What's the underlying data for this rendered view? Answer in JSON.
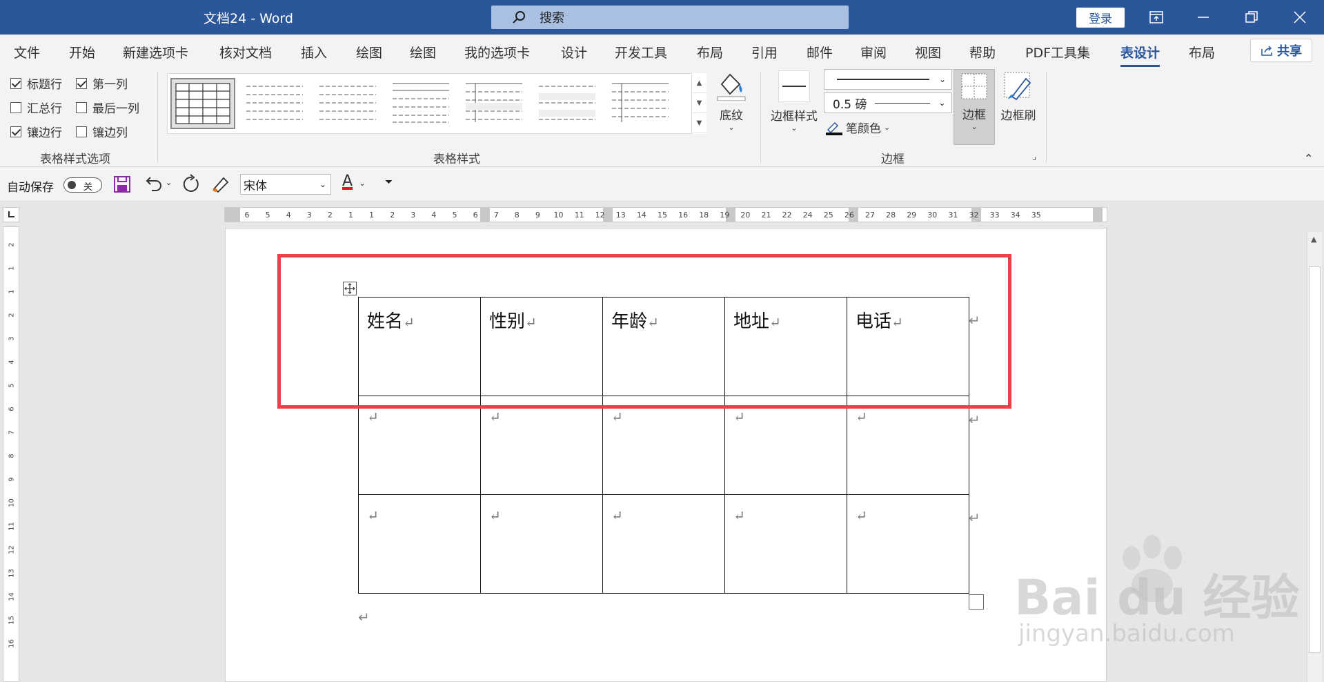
{
  "titlebar": {
    "doc_title": "文档24  -  Word",
    "search_placeholder": "搜索",
    "login_label": "登录"
  },
  "tabs": [
    "文件",
    "开始",
    "新建选项卡",
    "核对文档",
    "插入",
    "绘图",
    "绘图",
    "我的选项卡",
    "设计",
    "开发工具",
    "布局",
    "引用",
    "邮件",
    "审阅",
    "视图",
    "帮助",
    "PDF工具集",
    "表设计",
    "布局"
  ],
  "active_tab": "表设计",
  "share_label": "共享",
  "ribbon": {
    "style_options": {
      "header_row": "标题行",
      "first_column": "第一列",
      "total_row": "汇总行",
      "last_column": "最后一列",
      "banded_rows": "镶边行",
      "banded_columns": "镶边列",
      "group_label": "表格样式选项"
    },
    "styles_group_label": "表格样式",
    "shading_label": "底纹",
    "border_styles_label": "边框样式",
    "pen_weight": "0.5 磅",
    "pen_color_label": "笔颜色",
    "borders_label": "边框",
    "border_painter_label": "边框刷",
    "borders_group_label": "边框",
    "checked": {
      "header_row": true,
      "first_column": true,
      "total_row": false,
      "last_column": false,
      "banded_rows": true,
      "banded_columns": false
    }
  },
  "qat": {
    "autosave_label": "自动保存",
    "autosave_state": "关",
    "font_name": "宋体",
    "font_color_letter": "A"
  },
  "ruler": {
    "labels": [
      "6",
      "5",
      "4",
      "3",
      "2",
      "1",
      "1",
      "2",
      "3",
      "4",
      "5",
      "6",
      "7",
      "8",
      "9",
      "10",
      "11",
      "12",
      "13",
      "14",
      "15",
      "16",
      "18",
      "19",
      "20",
      "21",
      "22",
      "24",
      "25",
      "26",
      "27",
      "28",
      "29",
      "30",
      "31",
      "32",
      "33",
      "34",
      "35"
    ],
    "vertical_labels": [
      "2",
      "1",
      "1",
      "2",
      "3",
      "4",
      "5",
      "6",
      "7",
      "8",
      "9",
      "10",
      "11",
      "12",
      "13",
      "14",
      "15",
      "16"
    ]
  },
  "table": {
    "header": [
      "姓名",
      "性别",
      "年龄",
      "地址",
      "电话"
    ],
    "empty_rows": 2,
    "paragraph_mark": "↵"
  },
  "watermark": {
    "brand": "Bai du 经验",
    "url": "jingyan.baidu.com"
  },
  "colors": {
    "accent": "#2b579a",
    "highlight": "#e84348"
  }
}
